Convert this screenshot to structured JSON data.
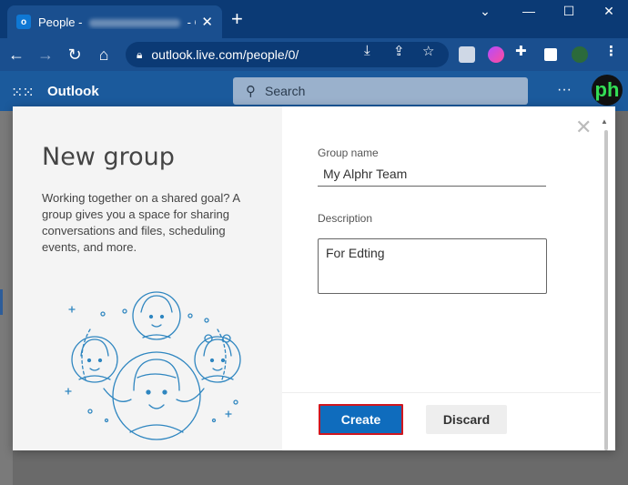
{
  "browser": {
    "tab": {
      "title_prefix": "People -",
      "title_suffix": "- Out",
      "favicon": "outlook-icon"
    },
    "new_tab_icon": "plus-icon",
    "url": "outlook.live.com/people/0/",
    "window_controls": [
      "chevron-down-icon",
      "minimize-icon",
      "maximize-icon",
      "close-icon"
    ]
  },
  "app": {
    "name": "Outlook",
    "search_placeholder": "Search",
    "avatar_text": "ph"
  },
  "dialog": {
    "title": "New group",
    "description": "Working together on a shared goal? A group gives you a space for sharing conversations and files, scheduling events, and more.",
    "group_name_label": "Group name",
    "group_name_value": "My Alphr Team",
    "description_label": "Description",
    "description_value": "For Edting",
    "create_label": "Create",
    "discard_label": "Discard"
  },
  "colors": {
    "primary": "#0f6cbd",
    "highlight": "#d0171f",
    "header": "#1b5a9c",
    "illustration": "#2f86c0"
  }
}
